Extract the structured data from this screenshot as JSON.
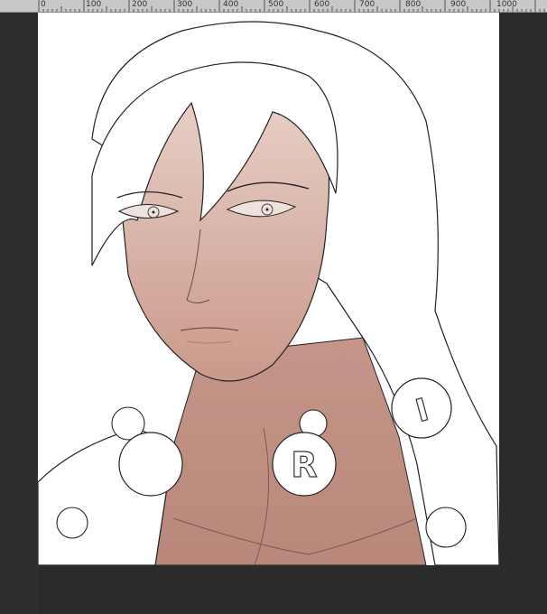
{
  "ruler": {
    "labels": [
      "0",
      "100",
      "200",
      "300",
      "400",
      "500",
      "600",
      "700",
      "800",
      "900",
      "1000"
    ]
  },
  "canvas": {
    "background": "#ffffff",
    "skin_color": "#d9b3a6",
    "line_color": "#222222",
    "ornaments": {
      "bead_left_letter": "",
      "bead_center_letter": "R",
      "bead_right_letter": "I"
    }
  },
  "colors": {
    "workspace": "#2b2b2b",
    "ruler_bg": "#c8c8c8"
  }
}
